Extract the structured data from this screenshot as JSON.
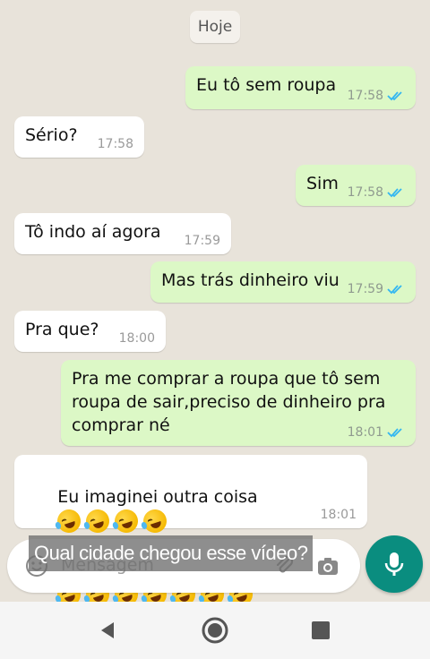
{
  "date_chip": "Hoje",
  "messages": [
    {
      "text": "Eu tô sem roupa",
      "time": "17:58",
      "dir": "out"
    },
    {
      "text": "Sério?",
      "time": "17:58",
      "dir": "in"
    },
    {
      "text": "Sim",
      "time": "17:58",
      "dir": "out"
    },
    {
      "text": "Tô indo aí agora",
      "time": "17:59",
      "dir": "in"
    },
    {
      "text": "Mas trás dinheiro viu",
      "time": "17:59",
      "dir": "out"
    },
    {
      "text": "Pra que?",
      "time": "18:00",
      "dir": "in"
    },
    {
      "text": "Pra me comprar a roupa que tô sem\nroupa de sair,preciso de dinheiro pra\ncomprar né",
      "time": "18:01",
      "dir": "out"
    },
    {
      "text": "Eu imaginei outra coisa",
      "time": "18:01",
      "dir": "in",
      "emoji": "rolling-on-the-floor-laughing",
      "emoji_count": 11
    }
  ],
  "input": {
    "placeholder": "Mensagem"
  },
  "overlay_caption": "Qual cidade chegou esse vídeo?",
  "colors": {
    "outgoing": "#dcf8c6",
    "incoming": "#ffffff",
    "accent": "#0a8d7f",
    "read_ticks": "#34b7f1"
  },
  "icons": {
    "emoji": "smiley-icon",
    "attach": "paperclip-icon",
    "camera": "camera-icon",
    "mic": "mic-icon",
    "nav_back": "back-triangle-icon",
    "nav_home": "home-circle-icon",
    "nav_recent": "recents-square-icon"
  }
}
